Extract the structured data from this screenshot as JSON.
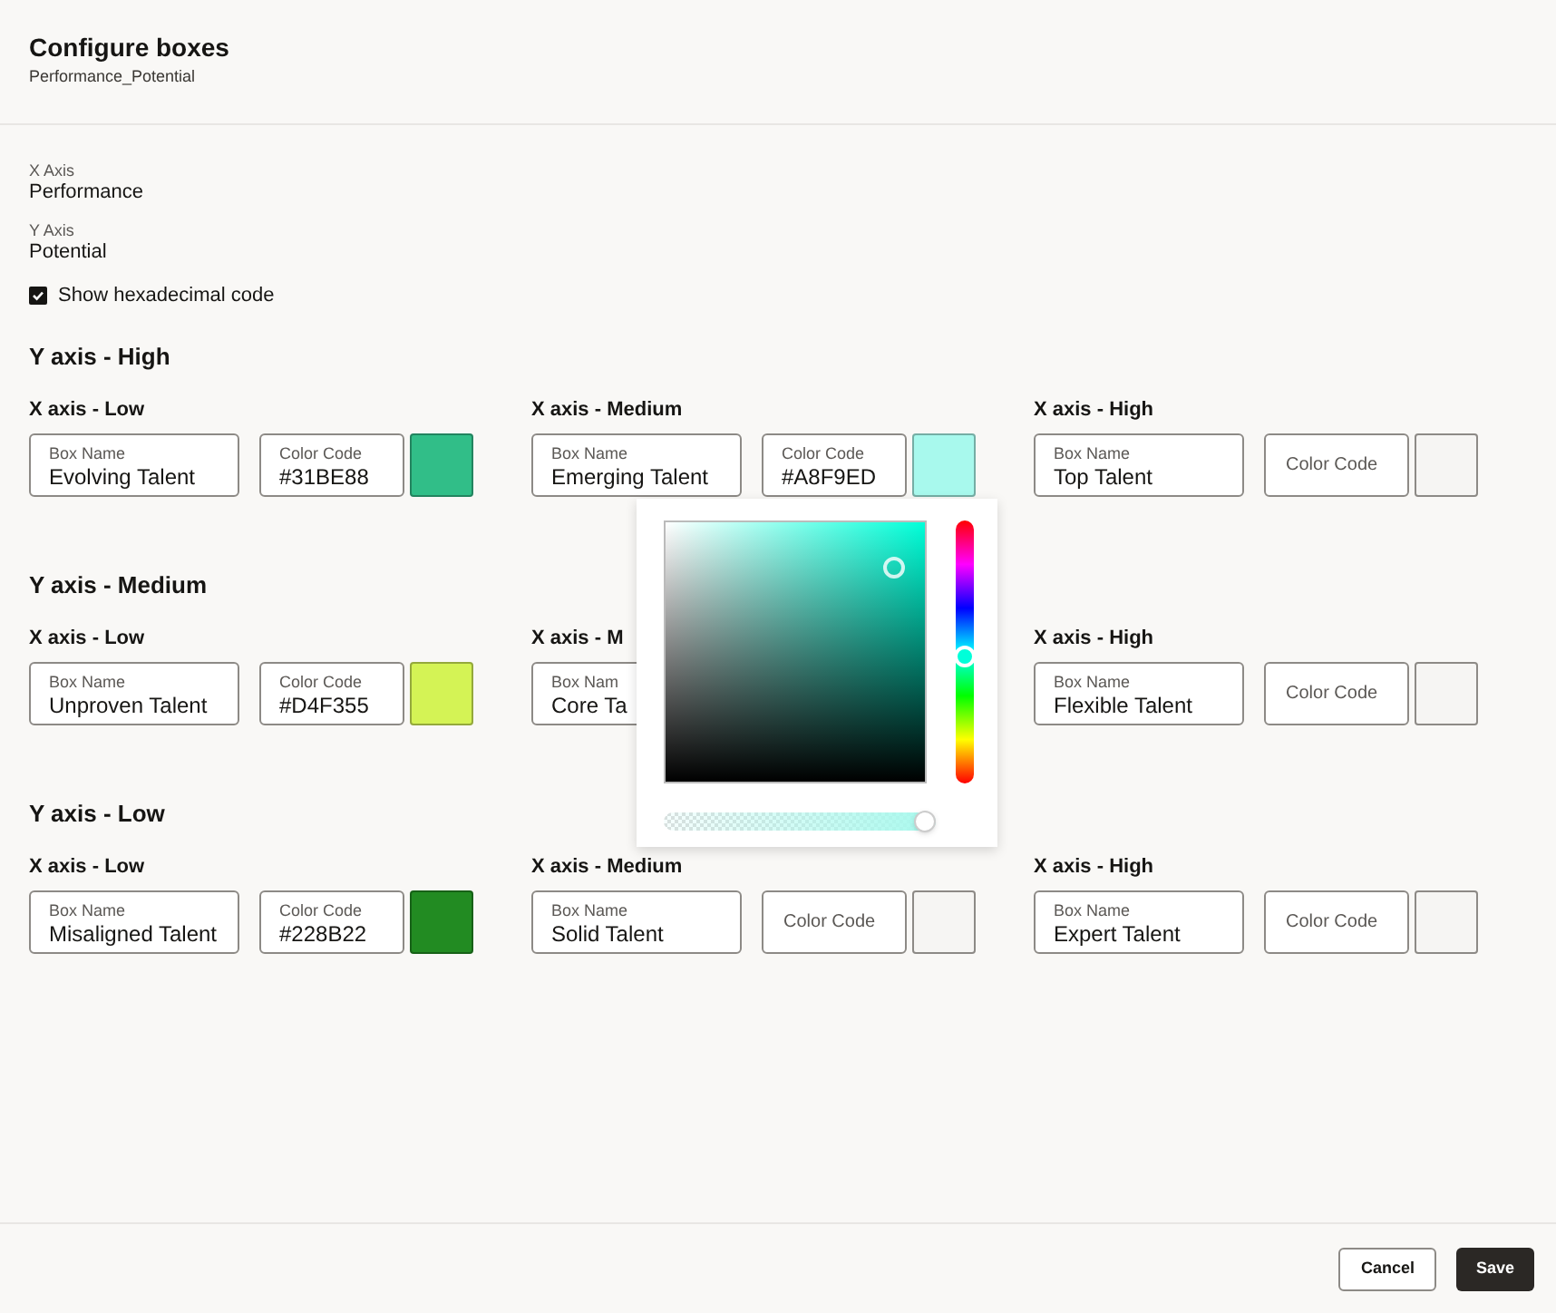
{
  "header": {
    "title": "Configure boxes",
    "subtitle": "Performance_Potential"
  },
  "axes": [
    {
      "label": "X Axis",
      "value": "Performance"
    },
    {
      "label": "Y Axis",
      "value": "Potential"
    }
  ],
  "show_hex": {
    "label": "Show hexadecimal code",
    "checked": true
  },
  "rows": [
    {
      "title": "Y axis - High",
      "cells": [
        {
          "heading": "X axis - Low",
          "box_name": {
            "label": "Box Name",
            "value": "Evolving Talent"
          },
          "color_code": {
            "label": "Color Code",
            "value": "#31BE88"
          },
          "swatch": {
            "color": "#31be88"
          }
        },
        {
          "heading": "X axis - Medium",
          "box_name": {
            "label": "Box Name",
            "value": "Emerging Talent"
          },
          "color_code": {
            "label": "Color Code",
            "value": "#A8F9ED"
          },
          "swatch": {
            "color": "#a8f9ed"
          },
          "picker": {
            "hue": {
              "level": 0.525
            },
            "saturation": {
              "level": 0.88
            },
            "brightness": {
              "level": 0.82
            },
            "alpha": {
              "level": 1
            }
          }
        },
        {
          "heading": "X axis - High",
          "box_name": {
            "label": "Box Name",
            "value": "Top Talent"
          },
          "color_code": {
            "placeholder": "Color Code"
          }
        }
      ]
    },
    {
      "title": "Y axis - Medium",
      "cells": [
        {
          "heading": "X axis - Low",
          "box_name": {
            "label": "Box Name",
            "value": "Unproven Talent"
          },
          "color_code": {
            "label": "Color Code",
            "value": "#D4F355"
          },
          "swatch": {
            "color": "#d4f355"
          }
        },
        {
          "heading": "X axis - M",
          "box_name": {
            "label": "Box Nam",
            "value": "Core Ta"
          }
        },
        {
          "heading": "X axis - High",
          "box_name": {
            "label": "Box Name",
            "value": "Flexible Talent"
          },
          "color_code": {
            "placeholder": "Color Code"
          }
        }
      ]
    },
    {
      "title": "Y axis - Low",
      "cells": [
        {
          "heading": "X axis - Low",
          "box_name": {
            "label": "Box Name",
            "value": "Misaligned Talent"
          },
          "color_code": {
            "label": "Color Code",
            "value": "#228B22"
          },
          "swatch": {
            "color": "#228b22"
          }
        },
        {
          "heading": "X axis - Medium",
          "box_name": {
            "label": "Box Name",
            "value": "Solid Talent"
          },
          "color_code": {
            "placeholder": "Color Code"
          }
        },
        {
          "heading": "X axis - High",
          "box_name": {
            "label": "Box Name",
            "value": "Expert Talent"
          },
          "color_code": {
            "placeholder": "Color Code"
          }
        }
      ]
    }
  ],
  "buttons": [
    {
      "label": "Cancel",
      "kind": "secondary"
    },
    {
      "label": "Save",
      "kind": "primary"
    }
  ]
}
